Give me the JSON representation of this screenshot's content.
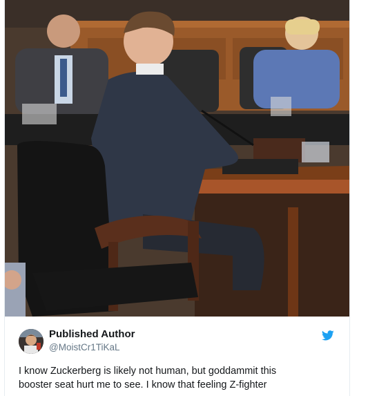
{
  "tweet": {
    "display_name": "Published Author",
    "handle": "@MoistCr1TiKaL",
    "text_line_1": "I know Zuckerberg is likely not human, but goddammit this",
    "text_line_2": "booster seat hurt me to see. I know that feeling Z-fighter"
  },
  "icons": {
    "brand": "twitter-bird-icon",
    "avatar": "profile-avatar"
  },
  "colors": {
    "twitter_blue": "#1da1f2",
    "name_text": "#14171a",
    "handle_text": "#657786"
  }
}
